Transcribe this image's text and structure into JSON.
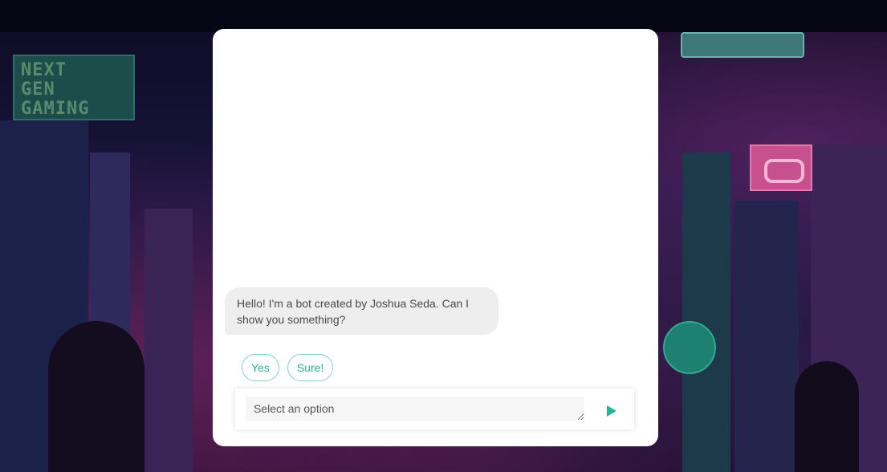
{
  "colors": {
    "accent": "#2bb39a",
    "bubble_background": "#eeeeee",
    "chat_background": "#ffffff"
  },
  "chat": {
    "bot_message": "Hello! I'm a bot created by Joshua Seda. Can I show you something?",
    "options": [
      {
        "label": "Yes"
      },
      {
        "label": "Sure!"
      }
    ],
    "input": {
      "placeholder": "Select an option",
      "value": ""
    },
    "send_icon": "send-triangle-icon"
  },
  "background": {
    "sign_text": [
      "NEXT",
      "GEN",
      "GAMING"
    ]
  }
}
